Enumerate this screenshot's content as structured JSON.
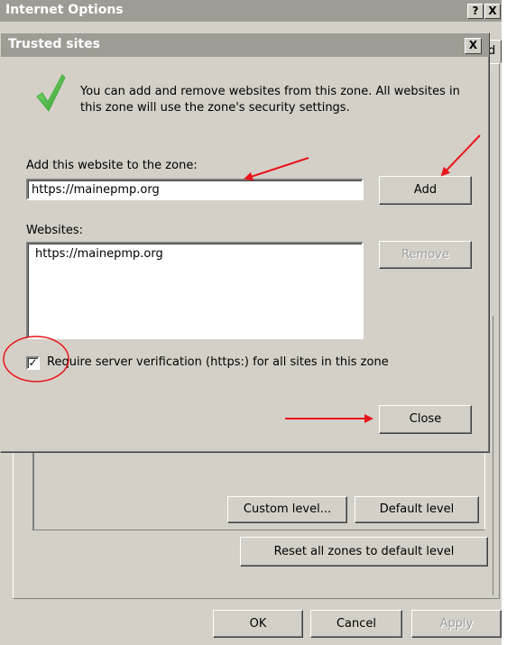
{
  "parent_window": {
    "title": "Internet Options",
    "help_label": "?",
    "close_label": "X",
    "tab_fragment": "d",
    "buttons": {
      "custom_level": "Custom level...",
      "default_level": "Default level",
      "reset_all": "Reset all zones to default level",
      "ok": "OK",
      "cancel": "Cancel",
      "apply": "Apply"
    }
  },
  "dialog": {
    "title": "Trusted sites",
    "close_label": "X",
    "info_text": "You can add and remove websites from this zone. All websites in this zone will use the zone's security settings.",
    "add_label": "Add this website to the zone:",
    "site_input_value": "https://mainepmp.org",
    "add_button": "Add",
    "websites_label": "Websites:",
    "websites": [
      "https://mainepmp.org"
    ],
    "remove_button": "Remove",
    "verify_checked": true,
    "verify_check_glyph": "✓",
    "verify_label": "Require server verification (https:) for all sites in this zone",
    "close_button": "Close"
  },
  "annotation_color": "#e8141b",
  "check_icon_color": "#3fb13d"
}
